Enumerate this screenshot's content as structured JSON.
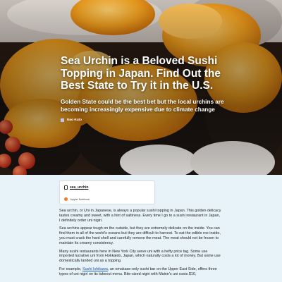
{
  "hero": {
    "title": "Sea Urchin is a Beloved Sushi Topping in Japan. Find Out the Best State to Try it in the U.S.",
    "subtitle": "Golden State could be the best bet but the local urchins are becoming increasingly expensive due to climate change",
    "author": "Nao Kato"
  },
  "embed": {
    "username": "sea_urchin",
    "source": "Jupyter Notebook"
  },
  "article": {
    "p1": "Sea urchin, or Uni in Japanese, is always a popular sushi topping in Japan. This golden delicacy tastes creamy and sweet, with a hint of saltiness. Every time I go to a sushi restaurant in Japan, I definitely order uni nigiri.",
    "p2": "Sea urchins appear tough on the outside, but they are extremely delicate on the inside. You can find them in all of the world's oceans but they are difficult to harvest. To eat the edible roe inside, you must crack the hard shell and carefully remove the meat. The meat should not be frozen to maintain its creamy consistency.",
    "p3": "Many sushi restaurants here in New York City serve uni with a hefty price tag. Some use imported lucrative uni from Hokkaido, Japan, which naturally costs a lot of money. But some use domestically landed uni as a topping.",
    "p4_before": "For example, ",
    "p4_link": "Sushi Ishikawa",
    "p4_after": ", an omakase-only sushi bar on the Upper East Side, offers three types of uni nigiri on its takeout menu. Bite-sized nigiri with Maine's uni costs $10,"
  },
  "colors": {
    "content_bg": "#e7f3f9",
    "link": "#1a56b8",
    "uni": "#f0a020"
  }
}
